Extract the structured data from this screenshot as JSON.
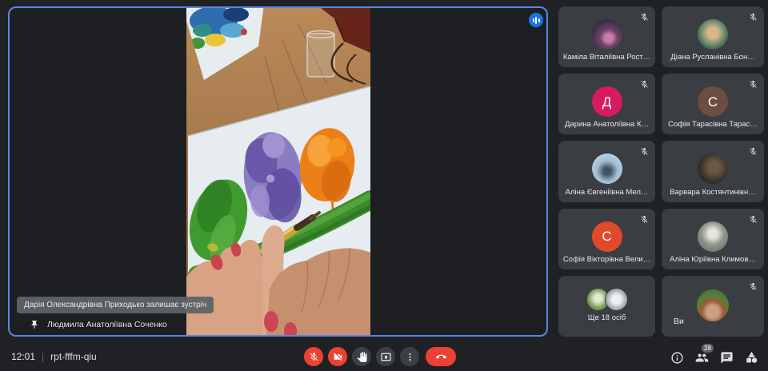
{
  "main_tile": {
    "toast_text": "Дарія Олександрівна Приходько залишає зустріч",
    "pinned_participant": "Людмила Анатоліївна Соченко",
    "pin_icon": "pin-icon",
    "speaking_indicator_icon": "audio-waveform-icon",
    "video_description": "Hands with red nail polish painting leaves (purple, orange, green) on white paper with a brush, on a wooden desk with a glass cup and another painted sheet"
  },
  "participants": [
    {
      "name": "Каміла Віталіївна Рост…",
      "avatar": "photo",
      "mic": "muted"
    },
    {
      "name": "Діана Русланівна Бон…",
      "avatar": "photo",
      "mic": "muted"
    },
    {
      "name": "Дарина Анатоліївна К…",
      "avatar": "initial",
      "initial": "Д",
      "avatar_color": "#d81b60",
      "mic": "muted"
    },
    {
      "name": "Софія Тарасівна Тарас…",
      "avatar": "initial",
      "initial": "С",
      "avatar_color": "#6d4c41",
      "mic": "muted"
    },
    {
      "name": "Аліна Євгеніївна Мел…",
      "avatar": "photo",
      "mic": "muted"
    },
    {
      "name": "Варвара Костянтинівн…",
      "avatar": "photo",
      "mic": "muted"
    },
    {
      "name": "Софія Вікторівна Вели…",
      "avatar": "initial",
      "initial": "С",
      "avatar_color": "#e1492b",
      "mic": "muted"
    },
    {
      "name": "Аліна Юріївна Климов…",
      "avatar": "photo",
      "mic": "muted"
    },
    {
      "name": "Ще 18 осіб",
      "avatar": "group",
      "mic": "none"
    },
    {
      "name": "Ви",
      "avatar": "photo",
      "mic": "muted"
    }
  ],
  "bottom_bar": {
    "time": "12:01",
    "separator": "|",
    "meeting_code": "rpt-fffm-qiu",
    "controls": [
      {
        "icon": "mic-off-icon",
        "state": "muted",
        "color": "#ea4335"
      },
      {
        "icon": "camera-off-icon",
        "state": "off",
        "color": "#ea4335"
      },
      {
        "icon": "raise-hand-icon",
        "state": "idle"
      },
      {
        "icon": "present-screen-icon",
        "state": "idle"
      },
      {
        "icon": "more-options-icon",
        "state": "idle"
      },
      {
        "icon": "leave-call-icon",
        "state": "idle",
        "color": "#ea4335"
      }
    ],
    "right_icons": [
      {
        "icon": "info-icon"
      },
      {
        "icon": "people-icon",
        "badge": "28"
      },
      {
        "icon": "chat-icon"
      },
      {
        "icon": "activities-icon"
      }
    ]
  },
  "colors": {
    "page_bg": "#202124",
    "participant_tile_bg": "#3a3d42",
    "active_speaker_border": "#5b86e0",
    "speaking_indicator": "#1a73e8",
    "control_red": "#ea4335",
    "control_neutral": "#3c4043",
    "toast_bg": "#5f6368",
    "text": "#e8eaed"
  }
}
